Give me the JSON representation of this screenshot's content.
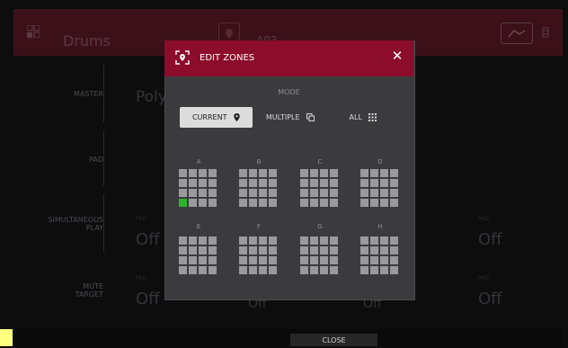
{
  "topbar": {
    "mode": "Drums",
    "id": "A03"
  },
  "sidebar": {
    "items": [
      "MASTER",
      "PAD",
      "SIMULTANEOUS\nPLAY",
      "MUTE\nTARGET"
    ]
  },
  "background": {
    "poly_value": "Poly",
    "off_values": [
      "Off",
      "Off",
      "Off",
      "Off",
      "Off",
      "Off"
    ]
  },
  "dialog": {
    "title": "EDIT ZONES",
    "mode_label": "MODE",
    "modes": [
      {
        "label": "CURRENT",
        "icon": "pin-icon",
        "selected": true
      },
      {
        "label": "MULTIPLE",
        "icon": "copy-icon",
        "selected": false
      },
      {
        "label": "ALL",
        "icon": "grid-icon",
        "selected": false
      }
    ],
    "zones": [
      "A",
      "B",
      "C",
      "D",
      "E",
      "F",
      "G",
      "H"
    ],
    "selected_zone": "A",
    "selected_pad_index": 12,
    "pad_color": "#9a9a9c",
    "selected_color": "#2bb52b"
  },
  "bottom": {
    "close_label": "CLOSE"
  },
  "colors": {
    "accent": "#8c0c2b",
    "topbar": "#3b1019"
  }
}
